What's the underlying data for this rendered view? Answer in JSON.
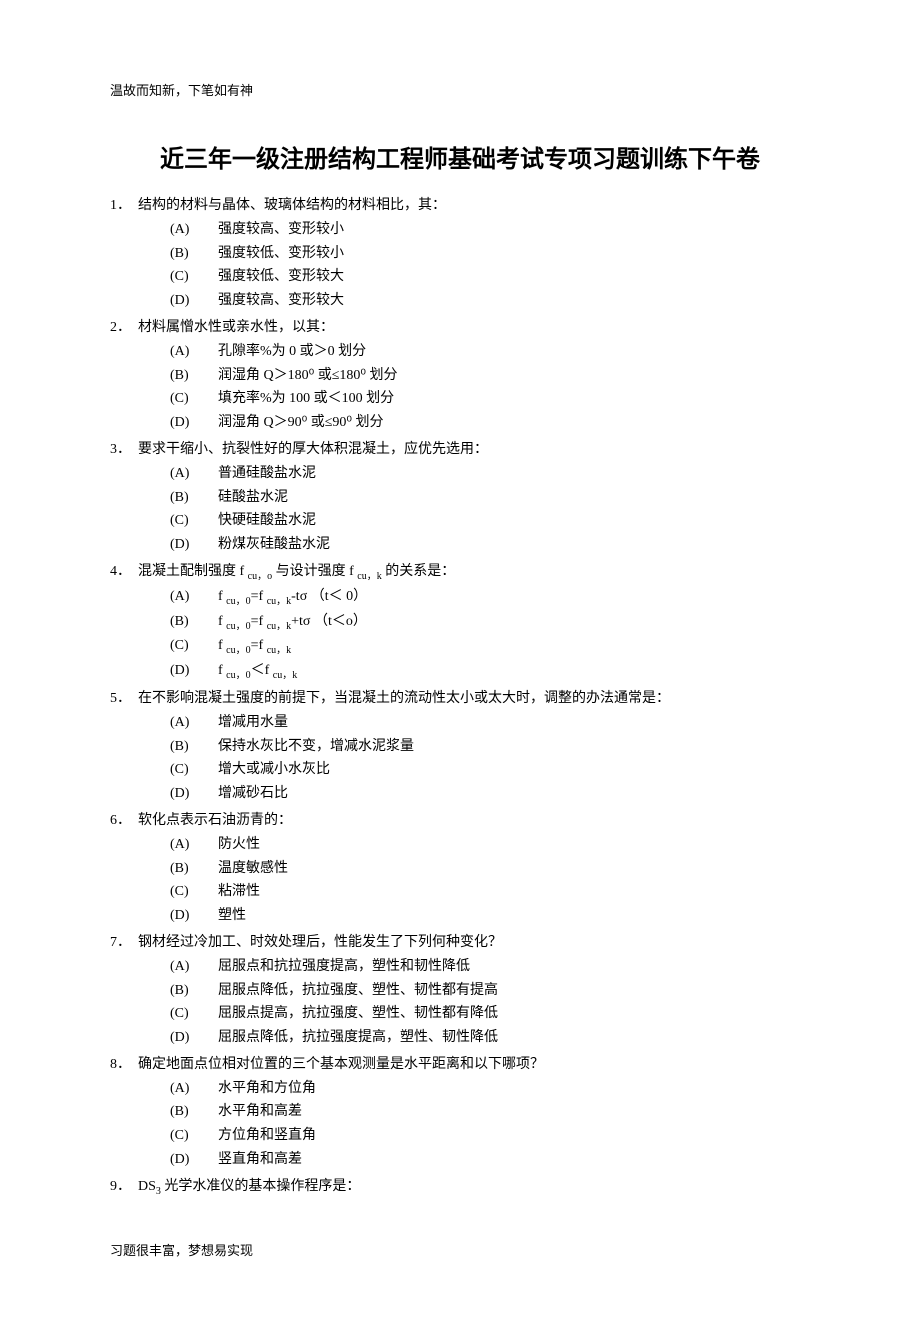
{
  "header_note": "温故而知新，下笔如有神",
  "title": "近三年一级注册结构工程师基础考试专项习题训练下午卷",
  "questions": [
    {
      "num": "1．",
      "stem": "结构的材料与晶体、玻璃体结构的材料相比，其：",
      "options": [
        {
          "label": "(A)",
          "text": "强度较高、变形较小"
        },
        {
          "label": "(B)",
          "text": "强度较低、变形较小"
        },
        {
          "label": "(C)",
          "text": "强度较低、变形较大"
        },
        {
          "label": "(D)",
          "text": "强度较高、变形较大"
        }
      ]
    },
    {
      "num": "2．",
      "stem": "材料属憎水性或亲水性，以其：",
      "options": [
        {
          "label": "(A)",
          "text": "孔隙率%为 0 或＞0 划分"
        },
        {
          "label": "(B)",
          "text": "润湿角 Q＞180⁰ 或≤180⁰ 划分"
        },
        {
          "label": "(C)",
          "text": "填充率%为 100 或＜100 划分"
        },
        {
          "label": "(D)",
          "text": "润湿角 Q＞90⁰ 或≤90⁰ 划分"
        }
      ]
    },
    {
      "num": "3．",
      "stem": "要求干缩小、抗裂性好的厚大体积混凝土，应优先选用：",
      "options": [
        {
          "label": "(A)",
          "text": "普通硅酸盐水泥"
        },
        {
          "label": "(B)",
          "text": "硅酸盐水泥"
        },
        {
          "label": "(C)",
          "text": "快硬硅酸盐水泥"
        },
        {
          "label": "(D)",
          "text": "粉煤灰硅酸盐水泥"
        }
      ]
    },
    {
      "num": "4．",
      "stem_html": "混凝土配制强度 f <sub>cu，o</sub> 与设计强度 f <sub>cu，k</sub> 的关系是：",
      "options_html": [
        {
          "label": "(A)",
          "text": "f <sub>cu，0</sub>=f <sub>cu，k</sub>-tσ （t＜ 0）"
        },
        {
          "label": "(B)",
          "text": "f <sub>cu，0</sub>=f <sub>cu，k</sub>+tσ （t＜o）"
        },
        {
          "label": "(C)",
          "text": "f <sub>cu，0</sub>=f <sub>cu，k</sub>"
        },
        {
          "label": "(D)",
          "text": "f <sub>cu，0</sub>＜f <sub>cu，k</sub>"
        }
      ]
    },
    {
      "num": "5．",
      "stem": "在不影响混凝土强度的前提下，当混凝土的流动性太小或太大时，调整的办法通常是：",
      "options": [
        {
          "label": "(A)",
          "text": "增减用水量"
        },
        {
          "label": "(B)",
          "text": "保持水灰比不变，增减水泥浆量"
        },
        {
          "label": "(C)",
          "text": "增大或减小水灰比"
        },
        {
          "label": "(D)",
          "text": "增减砂石比"
        }
      ]
    },
    {
      "num": "6．",
      "stem": "软化点表示石油沥青的：",
      "options": [
        {
          "label": "(A)",
          "text": "防火性"
        },
        {
          "label": "(B)",
          "text": "温度敏感性"
        },
        {
          "label": "(C)",
          "text": "粘滞性"
        },
        {
          "label": "(D)",
          "text": "塑性"
        }
      ]
    },
    {
      "num": "7．",
      "stem": "钢材经过冷加工、时效处理后，性能发生了下列何种变化？",
      "options": [
        {
          "label": "(A)",
          "text": "屈服点和抗拉强度提高，塑性和韧性降低"
        },
        {
          "label": "(B)",
          "text": "屈服点降低，抗拉强度、塑性、韧性都有提高"
        },
        {
          "label": "(C)",
          "text": "屈服点提高，抗拉强度、塑性、韧性都有降低"
        },
        {
          "label": "(D)",
          "text": "屈服点降低，抗拉强度提高，塑性、韧性降低"
        }
      ]
    },
    {
      "num": "8．",
      "stem": "确定地面点位相对位置的三个基本观测量是水平距离和以下哪项？",
      "options": [
        {
          "label": "(A)",
          "text": "水平角和方位角"
        },
        {
          "label": "(B)",
          "text": "水平角和高差"
        },
        {
          "label": "(C)",
          "text": "方位角和竖直角"
        },
        {
          "label": "(D)",
          "text": "竖直角和高差"
        }
      ]
    },
    {
      "num": "9．",
      "stem_html": "DS<sub>3</sub> 光学水准仪的基本操作程序是："
    }
  ],
  "footer_note": "习题很丰富，梦想易实现"
}
